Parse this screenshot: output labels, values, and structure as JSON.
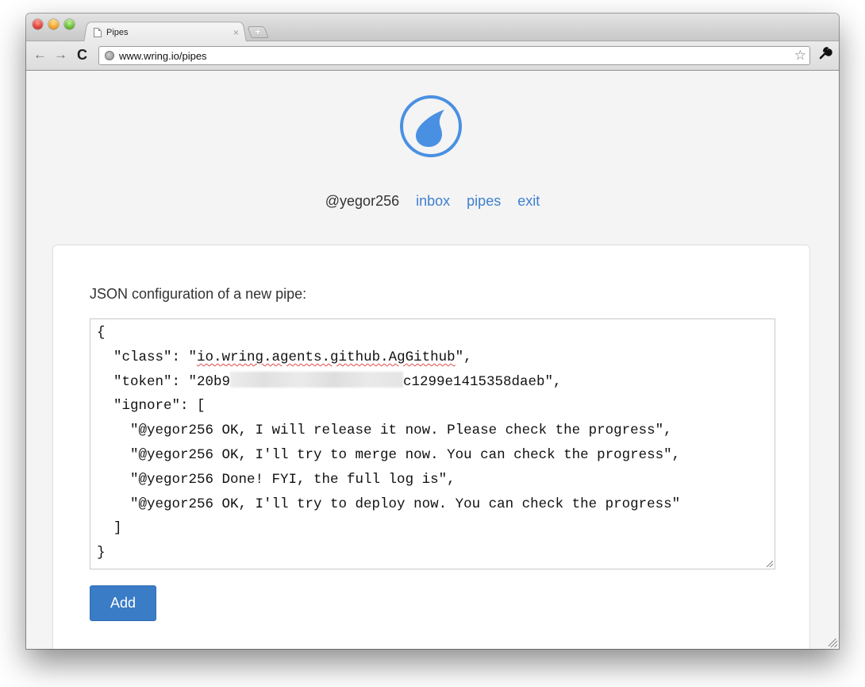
{
  "browser": {
    "tab": {
      "title": "Pipes",
      "close_icon": "×",
      "new_tab_icon": "+"
    },
    "toolbar": {
      "back_icon": "←",
      "forward_icon": "→",
      "reload_icon": "C",
      "url": "www.wring.io/pipes",
      "star_icon": "☆"
    }
  },
  "header": {
    "logo": "water-drop-logo",
    "username": "@yegor256",
    "nav": [
      {
        "label": "inbox"
      },
      {
        "label": "pipes"
      },
      {
        "label": "exit"
      }
    ]
  },
  "form": {
    "label": "JSON configuration of a new pipe:",
    "config": {
      "open_brace": "{",
      "class_key": "  \"class\": \"",
      "class_value": "io.wring.agents.github.AgGithub",
      "class_end": "\",",
      "token_key": "  \"token\": \"20b9",
      "token_tail": "c1299e1415358daeb\",",
      "ignore_key": "  \"ignore\": [",
      "ignore": [
        "    \"@yegor256 OK, I will release it now. Please check the progress\",",
        "    \"@yegor256 OK, I'll try to merge now. You can check the progress\",",
        "    \"@yegor256 Done! FYI, the full log is\",",
        "    \"@yegor256 OK, I'll try to deploy now. You can check the progress\""
      ],
      "close_bracket": "  ]",
      "close_brace": "}"
    },
    "submit_label": "Add"
  },
  "colors": {
    "link": "#3e7fcf",
    "logo": "#4a90e2",
    "button": "#3a7cc6"
  }
}
